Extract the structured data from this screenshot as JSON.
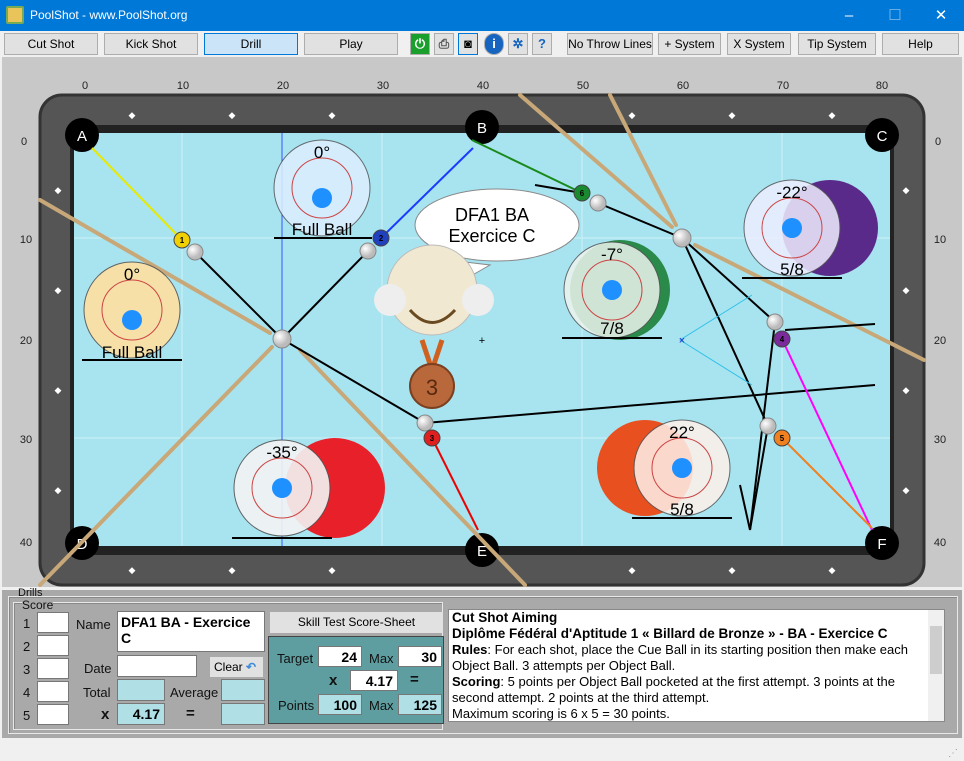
{
  "window": {
    "title": "PoolShot - www.PoolShot.org",
    "minimize": "–",
    "maximize": "☐",
    "close": "✕"
  },
  "toolbar": {
    "buttons": [
      "Cut Shot",
      "Kick Shot",
      "Drill",
      "Play"
    ],
    "selected": "Drill",
    "icons": [
      "power-icon",
      "printer-icon",
      "camera-icon",
      "info-icon",
      "settings-icon",
      "help-document-icon"
    ],
    "right_buttons": [
      "No Throw Lines",
      "+ System",
      "X System",
      "Tip System",
      "Help"
    ]
  },
  "table": {
    "x_ticks": [
      "0",
      "10",
      "20",
      "30",
      "40",
      "50",
      "60",
      "70",
      "80"
    ],
    "y_ticks": [
      "0",
      "10",
      "20",
      "30",
      "40"
    ],
    "pockets": [
      "A",
      "B",
      "C",
      "D",
      "E",
      "F"
    ],
    "bubble": {
      "line1": "DFA1 BA",
      "line2": "Exercice C"
    },
    "medal": "3",
    "balls": [
      "1",
      "2",
      "6",
      "4",
      "3",
      "5"
    ],
    "aims": [
      {
        "angle": "0°",
        "label": "Full Ball"
      },
      {
        "angle": "0°",
        "label": "Full Ball"
      },
      {
        "angle": "-35°",
        "label": ""
      },
      {
        "angle": "-7°",
        "label": "7/8"
      },
      {
        "angle": "-22°",
        "label": "5/8"
      },
      {
        "angle": "22°",
        "label": "5/8"
      }
    ],
    "colors": {
      "cloth": "#a8e4f0",
      "rail": "#555555",
      "cue_ball": "#f2f2f2"
    }
  },
  "drills": {
    "group_label": "Drills",
    "score_label": "Score",
    "rows": [
      "1",
      "2",
      "3",
      "4",
      "5"
    ],
    "name_label": "Name",
    "name_value": "DFA1 BA - Exercice C",
    "date_label": "Date",
    "date_value": "",
    "clear": "Clear",
    "total_label": "Total",
    "average_label": "Average",
    "x": "x",
    "multiplier": "4.17",
    "eq": "=",
    "score_sheet": "Skill Test Score-Sheet",
    "target_label": "Target",
    "target": "24",
    "max_label": "Max",
    "max": "30",
    "mult": "4.17",
    "points_label": "Points",
    "points": "100",
    "points_max": "125"
  },
  "description": {
    "title": "Cut Shot Aiming",
    "subtitle": "Diplôme Fédéral d'Aptitude 1 « Billard de Bronze » - BA - Exercice C",
    "rules_label": "Rules",
    "rules": ": For each shot, place the Cue Ball in its starting position then make each Object Ball. 3 attempts per Object Ball.",
    "scoring_label": "Scoring",
    "scoring": ": 5 points per Object Ball pocketed at the first attempt. 3 points at the second attempt. 2 points at the third attempt.",
    "max": "Maximum scoring is 6 x 5 = 30 points."
  }
}
